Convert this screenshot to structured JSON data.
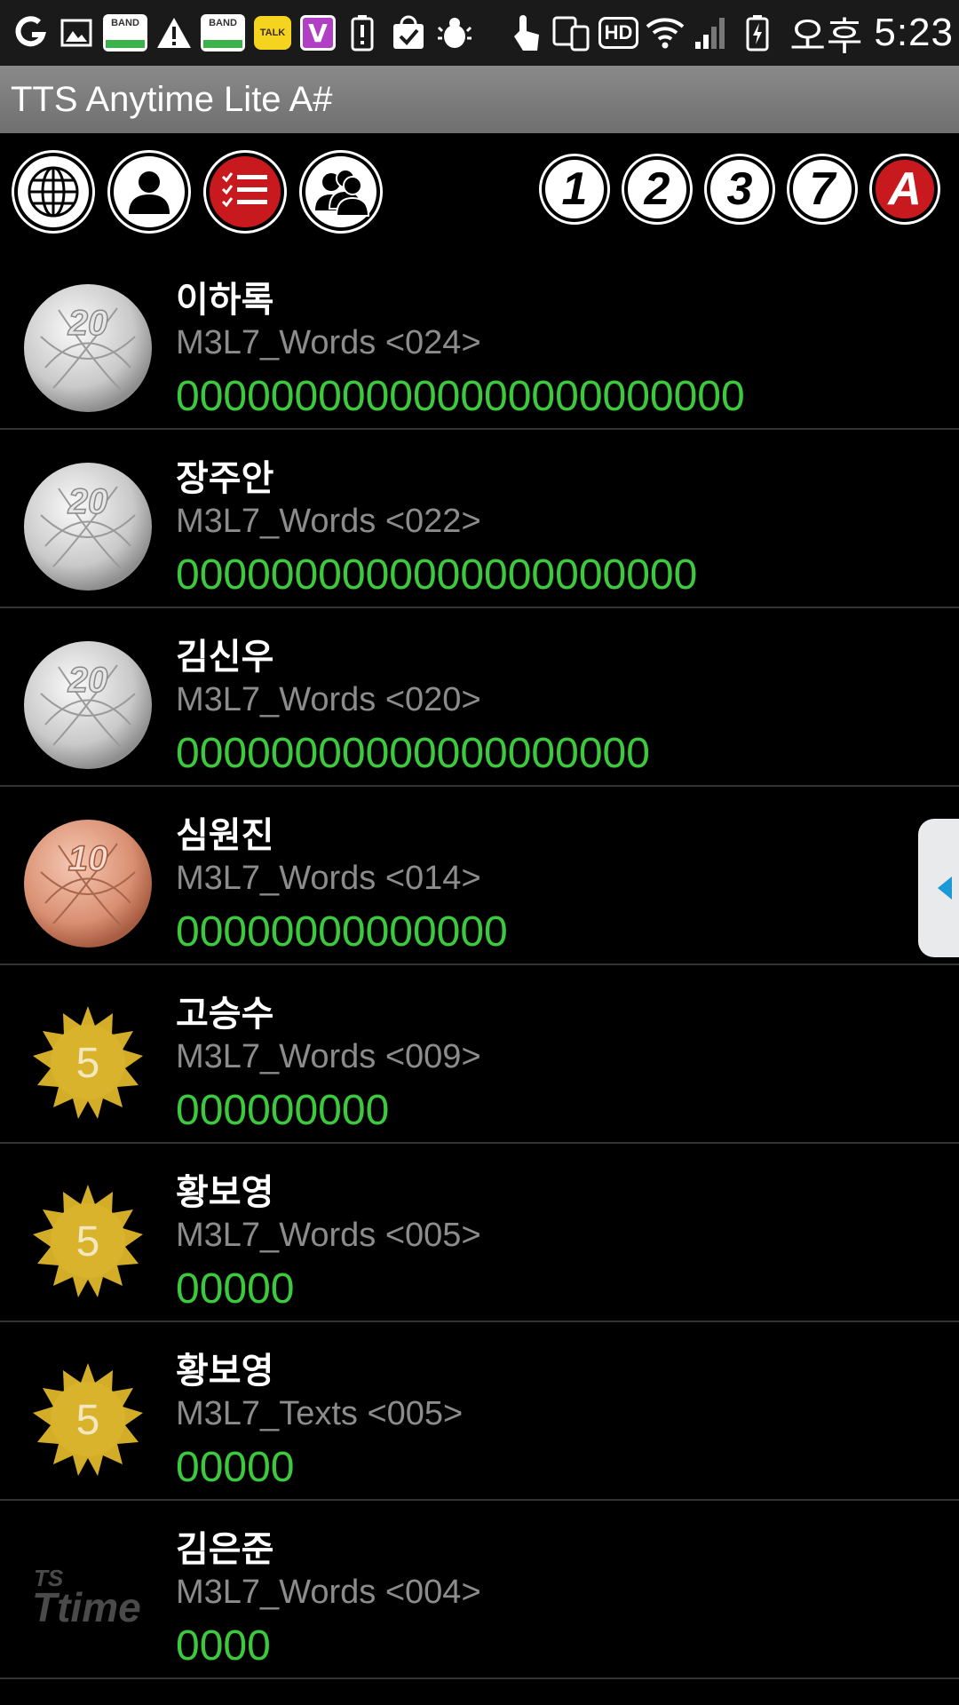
{
  "status_bar": {
    "band_label": "BAND",
    "talk_label": "TALK",
    "v_label": "V",
    "hd_label": "HD",
    "ampm": "오후",
    "time": "5:23"
  },
  "app": {
    "title": "TTS Anytime Lite A#"
  },
  "toolbar": {
    "mode_buttons": [
      "globe-icon",
      "single-user-icon",
      "checklist-icon",
      "group-users-icon"
    ],
    "level_buttons": [
      "1",
      "2",
      "3",
      "7",
      "A"
    ],
    "active_level": "A"
  },
  "list": [
    {
      "name": "이하록",
      "subtitle": "M3L7_Words <024>",
      "score": "000000000000000000000000",
      "medal": "20",
      "medal_type": "silver"
    },
    {
      "name": "장주안",
      "subtitle": "M3L7_Words <022>",
      "score": "0000000000000000000000",
      "medal": "20",
      "medal_type": "silver"
    },
    {
      "name": "김신우",
      "subtitle": "M3L7_Words <020>",
      "score": "00000000000000000000",
      "medal": "20",
      "medal_type": "silver"
    },
    {
      "name": "심원진",
      "subtitle": "M3L7_Words <014>",
      "score": "00000000000000",
      "medal": "10",
      "medal_type": "bronze"
    },
    {
      "name": "고승수",
      "subtitle": "M3L7_Words <009>",
      "score": "000000000",
      "medal": "5",
      "medal_type": "gold-star"
    },
    {
      "name": "황보영",
      "subtitle": "M3L7_Words <005>",
      "score": "00000",
      "medal": "5",
      "medal_type": "gold-star"
    },
    {
      "name": "황보영",
      "subtitle": "M3L7_Texts <005>",
      "score": "00000",
      "medal": "5",
      "medal_type": "gold-star"
    },
    {
      "name": "김은준",
      "subtitle": "M3L7_Words <004>",
      "score": "0000",
      "medal": "TS time",
      "medal_type": "logo"
    }
  ],
  "colors": {
    "score_green": "#3dc93d",
    "active_red": "#c8191f",
    "subtitle_gray": "#8c8c8c"
  }
}
